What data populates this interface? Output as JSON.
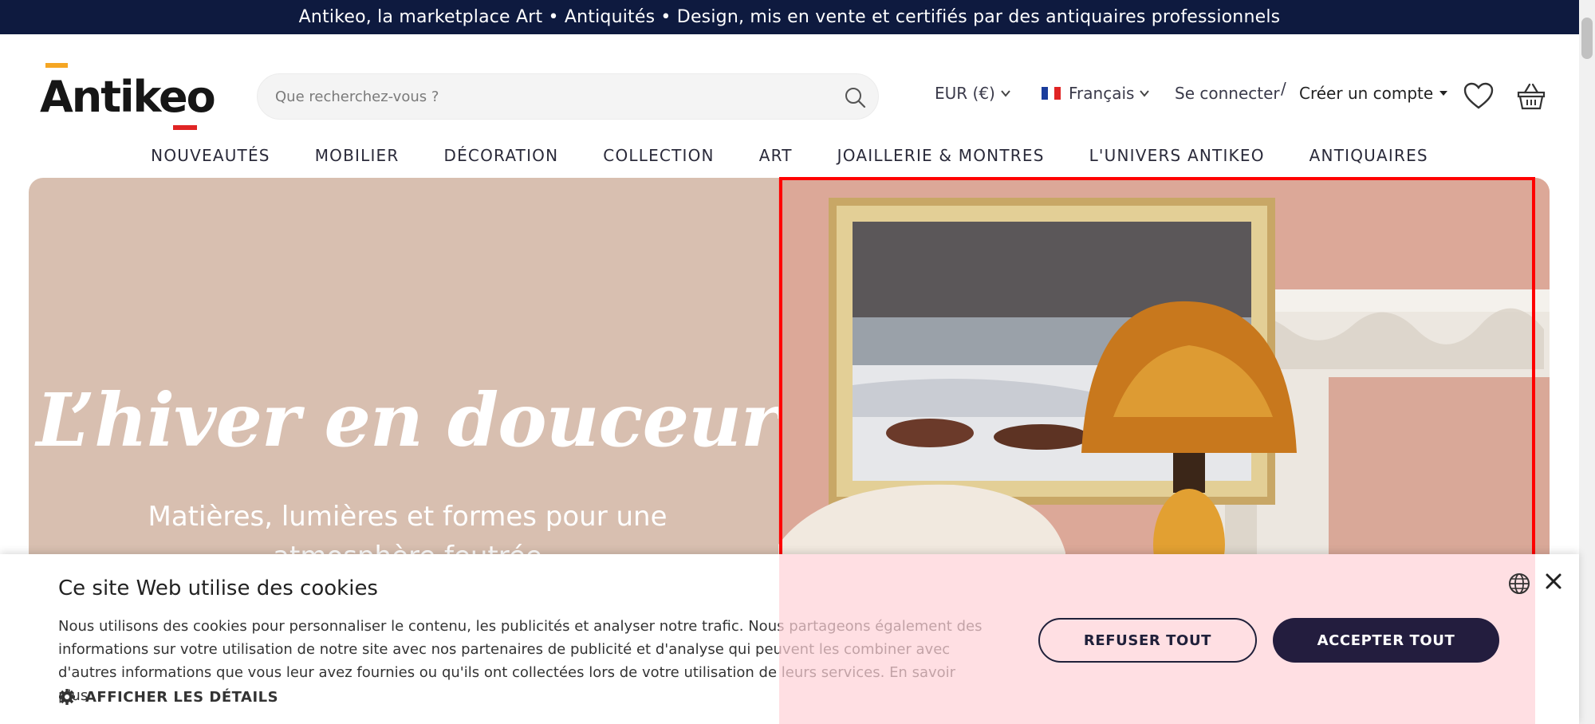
{
  "announcement": "Antikeo, la marketplace Art • Antiquités • Design, mis en vente et certifiés par des antiquaires professionnels",
  "logo": {
    "text": "Antikeo"
  },
  "search": {
    "placeholder": "Que recherchez-vous ?"
  },
  "header": {
    "currency": "EUR (€)",
    "language": "Français",
    "login": "Se connecter",
    "separator": "/",
    "register": "Créer un compte"
  },
  "nav": [
    "NOUVEAUTÉS",
    "MOBILIER",
    "DÉCORATION",
    "COLLECTION",
    "ART",
    "JOAILLERIE & MONTRES",
    "L'UNIVERS ANTIKEO",
    "ANTIQUAIRES"
  ],
  "hero": {
    "title": "L’hiver en douceur",
    "subtitle": "Matières, lumières et formes pour une atmosphère feutrée"
  },
  "cookie": {
    "title": "Ce site Web utilise des cookies",
    "text": "Nous utilisons des cookies pour personnaliser le contenu, les publicités et analyser notre trafic. Nous partageons également des informations sur votre utilisation de notre site avec nos partenaires de publicité et d'analyse qui peuvent les combiner avec d'autres informations que vous leur avez fournies ou qu'ils ont collectées lors de votre utilisation de leurs services.",
    "learn_more": "En savoir plus",
    "details": "AFFICHER LES DÉTAILS",
    "refuse": "REFUSER TOUT",
    "accept": "ACCEPTER TOUT"
  },
  "colors": {
    "topbar": "#0e1a3f",
    "hero_bg": "#d8bfb0",
    "accept_button": "#231d3e",
    "highlight": "#ff0000"
  }
}
